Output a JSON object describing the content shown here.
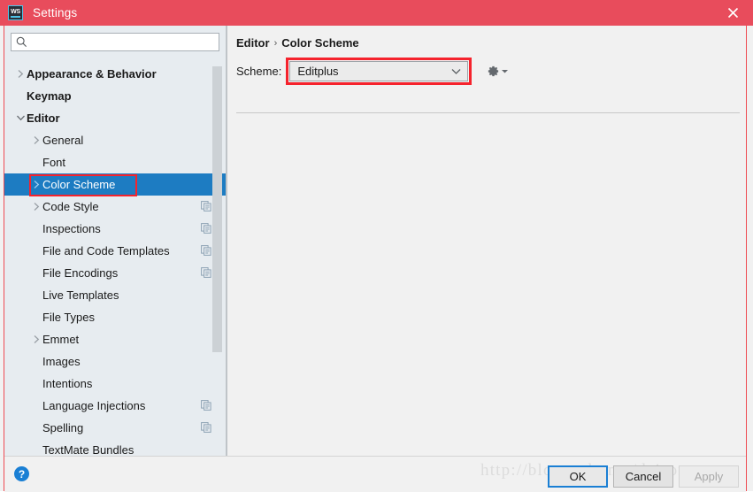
{
  "window": {
    "title": "Settings",
    "app_icon": "webstorm-icon",
    "close_icon": "close-icon",
    "titlebar_color": "#e84c5c",
    "annotation_color": "#f5232d",
    "selection_color": "#1d7cc2"
  },
  "search": {
    "value": "",
    "placeholder": "",
    "icon": "search-icon"
  },
  "tree": {
    "items": [
      {
        "label": "Appearance & Behavior",
        "level": 0,
        "bold": true,
        "arrow": "collapsed",
        "copy": false,
        "selected": false
      },
      {
        "label": "Keymap",
        "level": 0,
        "bold": true,
        "arrow": "none",
        "copy": false,
        "selected": false
      },
      {
        "label": "Editor",
        "level": 0,
        "bold": true,
        "arrow": "expanded",
        "copy": false,
        "selected": false
      },
      {
        "label": "General",
        "level": 1,
        "bold": false,
        "arrow": "collapsed",
        "copy": false,
        "selected": false
      },
      {
        "label": "Font",
        "level": 1,
        "bold": false,
        "arrow": "none",
        "copy": false,
        "selected": false
      },
      {
        "label": "Color Scheme",
        "level": 1,
        "bold": false,
        "arrow": "collapsed",
        "copy": false,
        "selected": true
      },
      {
        "label": "Code Style",
        "level": 1,
        "bold": false,
        "arrow": "collapsed",
        "copy": true,
        "selected": false
      },
      {
        "label": "Inspections",
        "level": 1,
        "bold": false,
        "arrow": "none",
        "copy": true,
        "selected": false
      },
      {
        "label": "File and Code Templates",
        "level": 1,
        "bold": false,
        "arrow": "none",
        "copy": true,
        "selected": false
      },
      {
        "label": "File Encodings",
        "level": 1,
        "bold": false,
        "arrow": "none",
        "copy": true,
        "selected": false
      },
      {
        "label": "Live Templates",
        "level": 1,
        "bold": false,
        "arrow": "none",
        "copy": false,
        "selected": false
      },
      {
        "label": "File Types",
        "level": 1,
        "bold": false,
        "arrow": "none",
        "copy": false,
        "selected": false
      },
      {
        "label": "Emmet",
        "level": 1,
        "bold": false,
        "arrow": "collapsed",
        "copy": false,
        "selected": false
      },
      {
        "label": "Images",
        "level": 1,
        "bold": false,
        "arrow": "none",
        "copy": false,
        "selected": false
      },
      {
        "label": "Intentions",
        "level": 1,
        "bold": false,
        "arrow": "none",
        "copy": false,
        "selected": false
      },
      {
        "label": "Language Injections",
        "level": 1,
        "bold": false,
        "arrow": "none",
        "copy": true,
        "selected": false
      },
      {
        "label": "Spelling",
        "level": 1,
        "bold": false,
        "arrow": "none",
        "copy": true,
        "selected": false
      },
      {
        "label": "TextMate Bundles",
        "level": 1,
        "bold": false,
        "arrow": "none",
        "copy": false,
        "selected": false
      }
    ]
  },
  "main": {
    "breadcrumb": {
      "parent": "Editor",
      "separator": "›",
      "current": "Color Scheme"
    },
    "scheme": {
      "label": "Scheme:",
      "value": "Editplus",
      "chevron_icon": "chevron-down-icon",
      "gear_icon": "gear-icon"
    }
  },
  "footer": {
    "help_label": "?",
    "watermark": "http://blog.csdn.net/daisongwu",
    "buttons": [
      {
        "label": "OK",
        "state": "focused"
      },
      {
        "label": "Cancel",
        "state": "normal"
      },
      {
        "label": "Apply",
        "state": "disabled"
      }
    ]
  }
}
